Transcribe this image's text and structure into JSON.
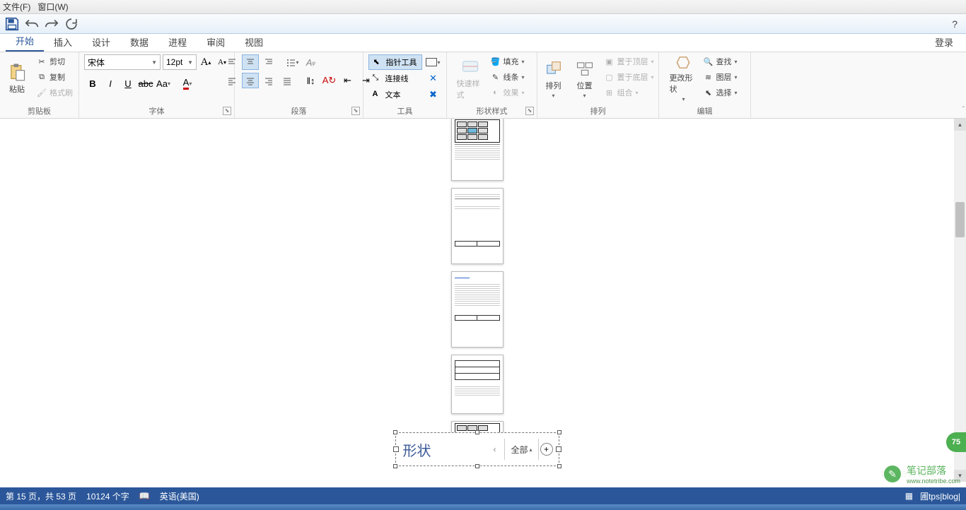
{
  "menubar": {
    "file": "文件(F)",
    "window": "窗口(W)"
  },
  "qat": {
    "help": "?"
  },
  "tabs": {
    "items": [
      "开始",
      "插入",
      "设计",
      "数据",
      "进程",
      "审阅",
      "视图"
    ],
    "active": 0,
    "login": "登录"
  },
  "ribbon": {
    "clipboard": {
      "label": "剪贴板",
      "paste": "粘贴",
      "cut": "剪切",
      "copy": "复制",
      "format_painter": "格式刷"
    },
    "font": {
      "label": "字体",
      "family": "宋体",
      "size": "12pt"
    },
    "paragraph": {
      "label": "段落"
    },
    "tools": {
      "label": "工具",
      "pointer": "指针工具",
      "connector": "连接线",
      "text": "文本"
    },
    "shape_styles": {
      "label": "形状样式",
      "quick": "快速样式",
      "fill": "填充",
      "line": "线条",
      "effect": "效果"
    },
    "arrange": {
      "label": "排列",
      "arrange": "排列",
      "position": "位置",
      "bring_front": "置于顶层",
      "send_back": "置于底层",
      "group": "组合"
    },
    "edit": {
      "label": "编辑",
      "change_shape": "更改形状",
      "find": "查找",
      "layer": "图层",
      "select": "选择"
    }
  },
  "shape_panel": {
    "title": "形状",
    "filter": "全部"
  },
  "status": {
    "page": "第 15 页，共 53 页",
    "words": "10124 个字",
    "lang": "英语(美国)",
    "url": "圃tps|blog|"
  },
  "badge": {
    "value": "75"
  },
  "watermark": {
    "brand": "笔记部落",
    "url": "www.notetribe.com"
  }
}
